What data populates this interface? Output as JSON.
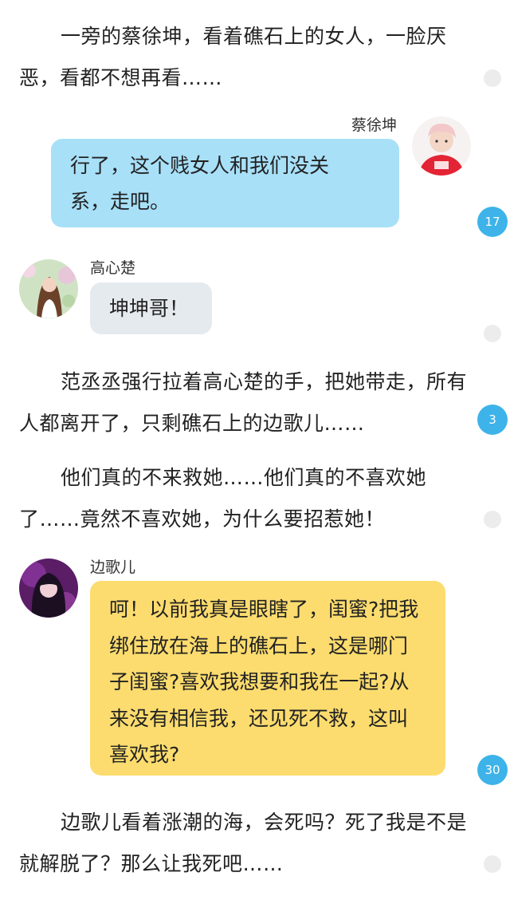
{
  "story": {
    "narration_1": "一旁的蔡徐坤，看着礁石上的女人，一脸厌恶，看都不想再看……",
    "narration_2": "范丞丞强行拉着高心楚的手，把她带走，所有人都离开了，只剩礁石上的边歌儿……",
    "narration_3": "他们真的不来救她……他们真的不喜欢她了……竟然不喜欢她，为什么要招惹她！",
    "narration_4": "边歌儿看着涨潮的海，会死吗？死了我是不是就解脱了？那么让我死吧……"
  },
  "dialogue": {
    "cai": {
      "name": "蔡徐坤",
      "text": "行了，这个贱女人和我们没关系，走吧。",
      "bubble_color": "#a8e0f8"
    },
    "gao": {
      "name": "高心楚",
      "text": "坤坤哥！",
      "bubble_color": "#e5eaee"
    },
    "bian": {
      "name": "边歌儿",
      "text": "呵！以前我真是眼瞎了，闺蜜?把我绑住放在海上的礁石上，这是哪门子闺蜜?喜欢我想要和我在一起?从来没有相信我，还见死不救，这叫喜欢我?",
      "bubble_color": "#fcdc6e"
    }
  },
  "comment_counts": {
    "cai": "17",
    "narration_2": "3",
    "bian": "30"
  },
  "colors": {
    "comment_badge": "#3db3e9",
    "empty_badge": "#ececec"
  }
}
